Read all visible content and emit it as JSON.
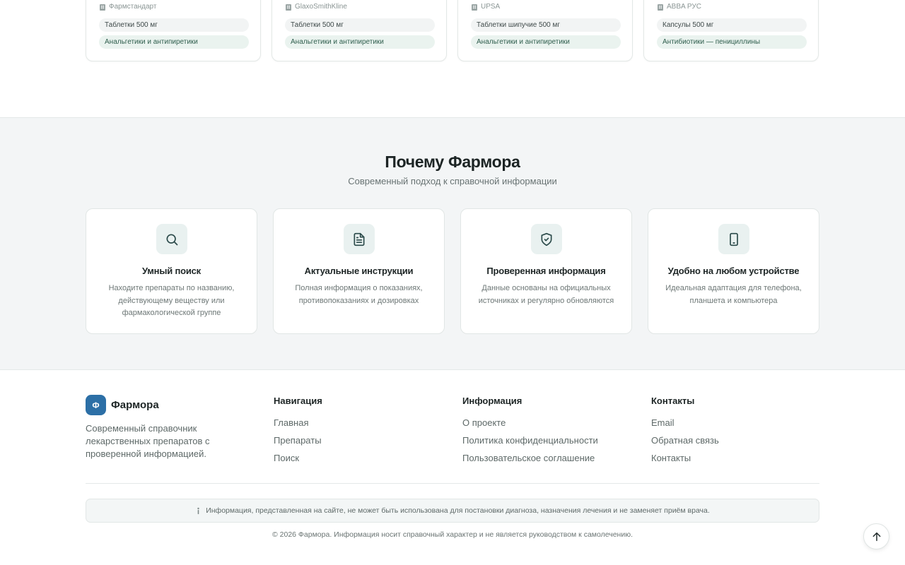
{
  "products": [
    {
      "manufacturer": "Фармстандарт",
      "form": "Таблетки 500 мг",
      "group": "Анальгетики и антипиретики"
    },
    {
      "manufacturer": "GlaxoSmithKline",
      "form": "Таблетки 500 мг",
      "group": "Анальгетики и антипиретики"
    },
    {
      "manufacturer": "UPSA",
      "form": "Таблетки шипучие 500 мг",
      "group": "Анальгетики и антипиретики"
    },
    {
      "manufacturer": "ABBA РУС",
      "form": "Капсулы 500 мг",
      "group": "Антибиотики — пенициллины"
    }
  ],
  "why": {
    "title": "Почему Фармора",
    "subtitle": "Современный подход к справочной информации",
    "features": [
      {
        "icon": "search-icon",
        "title": "Умный поиск",
        "desc": "Находите препараты по названию, действующему веществу или фармакологической группе"
      },
      {
        "icon": "document-icon",
        "title": "Актуальные инструкции",
        "desc": "Полная информация о показаниях, противопоказаниях и дозировках"
      },
      {
        "icon": "shield-check-icon",
        "title": "Проверенная информация",
        "desc": "Данные основаны на официальных источниках и регулярно обновляются"
      },
      {
        "icon": "phone-icon",
        "title": "Удобно на любом устройстве",
        "desc": "Идеальная адаптация для телефона, планшета и компьютера"
      }
    ]
  },
  "footer": {
    "brand_letter": "Ф",
    "brand_name": "Фармора",
    "brand_desc": "Современный справочник лекарственных препаратов с проверенной информацией.",
    "nav": {
      "title": "Навигация",
      "links": [
        "Главная",
        "Препараты",
        "Поиск"
      ]
    },
    "info": {
      "title": "Информация",
      "links": [
        "О проекте",
        "Политика конфиденциальности",
        "Пользовательское соглашение"
      ]
    },
    "contacts": {
      "title": "Контакты",
      "links": [
        "Email",
        "Обратная связь",
        "Контакты"
      ]
    },
    "disclaimer": "Информация, представленная на сайте, не может быть использована для постановки диагноза, назначения лечения и не заменяет приём врача.",
    "copyright": "© 2026 Фармора. Информация носит справочный характер и не является руководством к самолечению."
  },
  "colors": {
    "accent": "#2c6fa6",
    "icon_bg": "#e9f1f0",
    "section_bg": "#f3f5f6"
  }
}
